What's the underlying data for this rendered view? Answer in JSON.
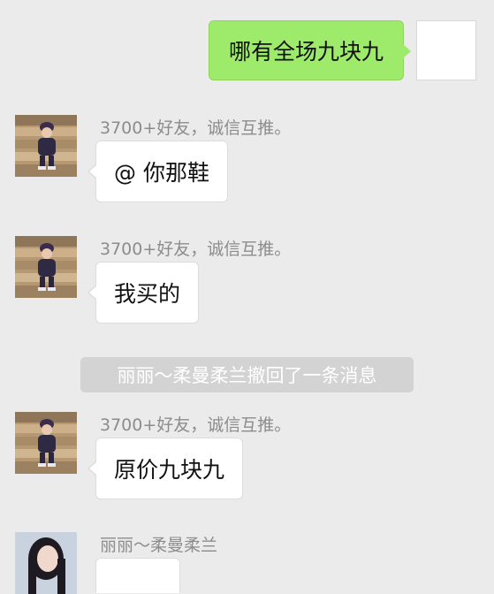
{
  "outgoing_message": {
    "text": "哪有全场九块九"
  },
  "messages": [
    {
      "sender": "3700+好友，诚信互推。",
      "text": "@ 你那鞋"
    },
    {
      "sender": "3700+好友，诚信互推。",
      "text": "我买的"
    },
    {
      "sender": "3700+好友，诚信互推。",
      "text": "原价九块九"
    }
  ],
  "system_notice": "丽丽～柔曼柔兰撤回了一条消息",
  "last_message": {
    "sender": "丽丽～柔曼柔兰"
  },
  "colors": {
    "background": "#ebebeb",
    "outgoing_bubble": "#9eea6a",
    "incoming_bubble": "#ffffff",
    "sender_text": "#8c8c8c",
    "notice_background": "#d3d3d3"
  }
}
